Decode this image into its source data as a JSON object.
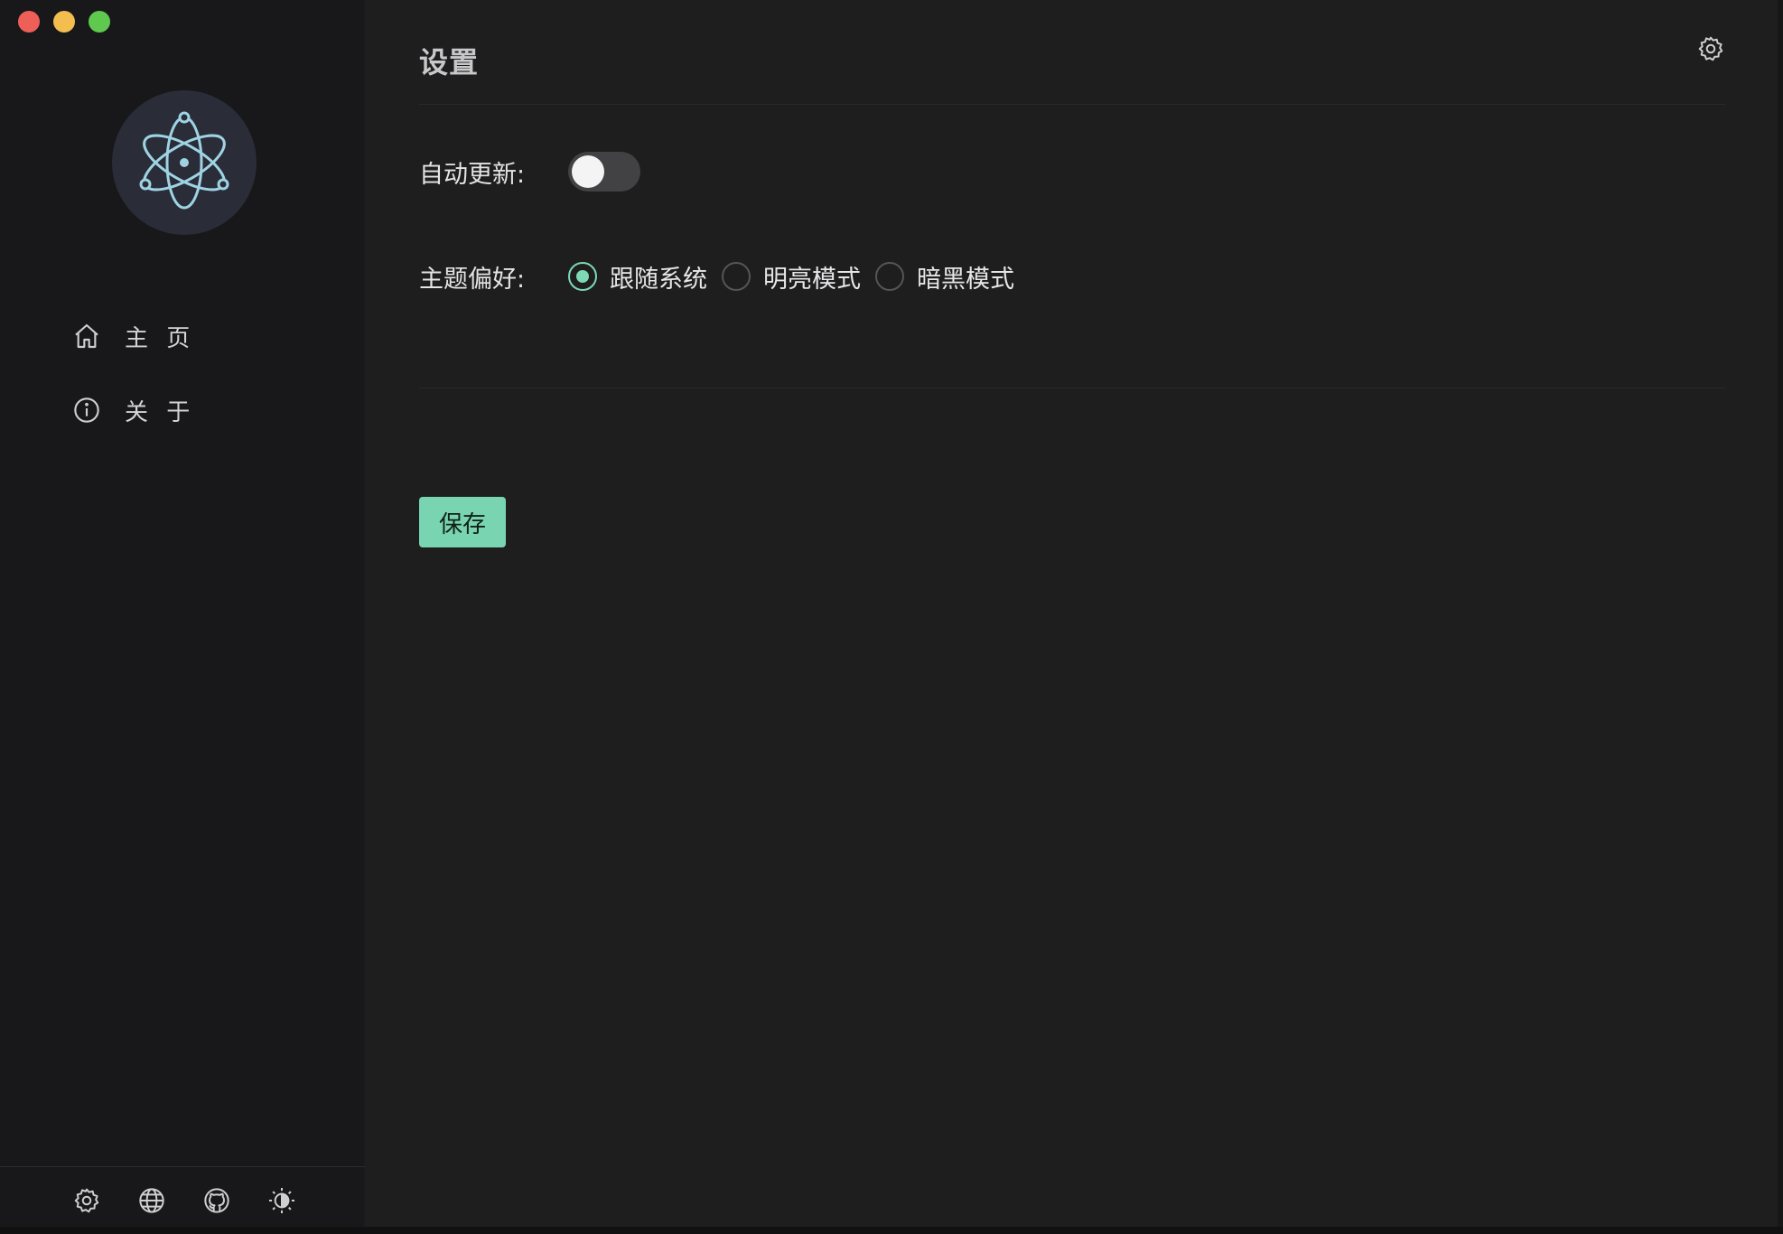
{
  "window": {
    "traffic_lights": {
      "close": "#ee5f57",
      "minimize": "#f4bd4f",
      "maximize": "#5fc84f"
    }
  },
  "sidebar": {
    "logo_icon": "electron-atom-icon",
    "nav": [
      {
        "label": "主 页",
        "icon": "home-icon"
      },
      {
        "label": "关 于",
        "icon": "info-icon"
      }
    ],
    "footer_icons": [
      "gear-icon",
      "globe-icon",
      "github-icon",
      "theme-icon"
    ]
  },
  "main": {
    "title": "设置",
    "settings_icon": "gear-icon",
    "auto_update": {
      "label": "自动更新:",
      "enabled": false
    },
    "theme": {
      "label": "主题偏好:",
      "options": [
        "跟随系统",
        "明亮模式",
        "暗黑模式"
      ],
      "selected": "跟随系统"
    },
    "save_label": "保存"
  },
  "colors": {
    "accent": "#7fd8b5",
    "background": "#1e1e1e",
    "sidebar": "#18181a"
  }
}
